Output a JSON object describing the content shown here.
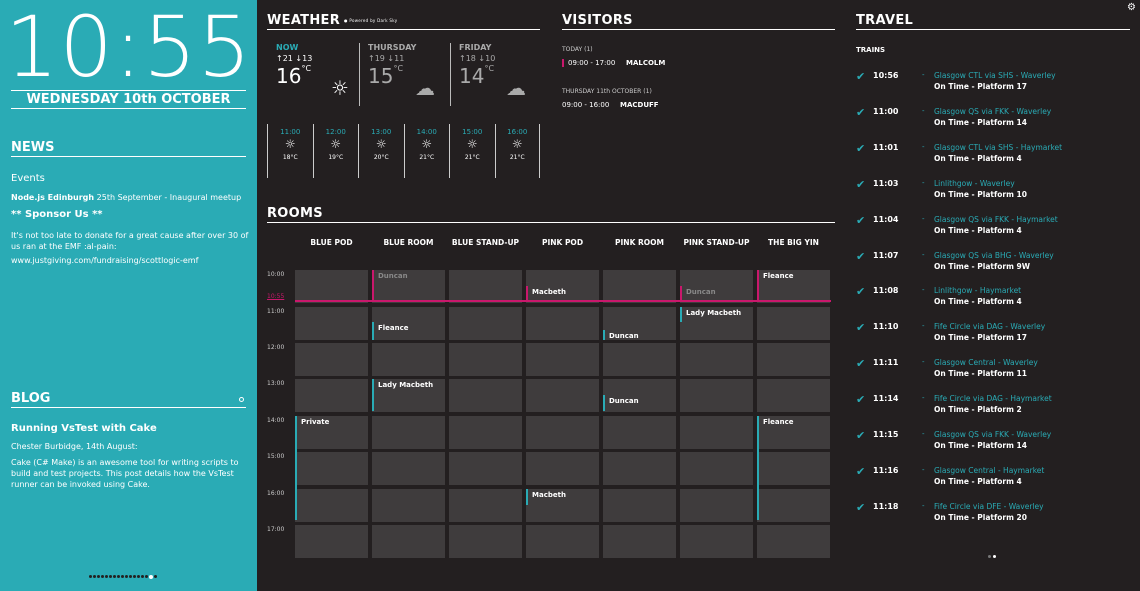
{
  "clock": {
    "time": "10:55",
    "date": "WEDNESDAY 10th OCTOBER"
  },
  "news": {
    "heading": "NEWS",
    "events_label": "Events",
    "event_title": "Node.js Edinburgh",
    "event_rest": " 25th September - Inaugural meetup",
    "sponsor": "** Sponsor Us **",
    "donate": "It's not too late to donate for a great cause after over 30 of us ran at the EMF :al-pain:",
    "link": "www.justgiving.com/fundraising/scottlogic-emf"
  },
  "blog": {
    "heading": "BLOG",
    "title": "Running VsTest with Cake",
    "author": "Chester Burbidge, 14th August:",
    "body": "Cake (C# Make) is an awesome tool for writing scripts to build and test projects. This post details how the VsTest runner can be invoked using Cake."
  },
  "weather": {
    "heading": "WEATHER",
    "powered": "Powered by Dark Sky",
    "days": [
      {
        "label": "NOW",
        "minmax": "↑21 ↓13",
        "temp": "16",
        "unit": "°C",
        "icon": "sun-icon",
        "glyph": "☼"
      },
      {
        "label": "THURSDAY",
        "minmax": "↑19 ↓11",
        "temp": "15",
        "unit": "°C",
        "icon": "rain-cloud-icon",
        "glyph": "☁"
      },
      {
        "label": "FRIDAY",
        "minmax": "↑18 ↓10",
        "temp": "14",
        "unit": "°C",
        "icon": "rain-cloud-icon",
        "glyph": "☁"
      }
    ],
    "hourly": [
      {
        "time": "11:00",
        "temp": "18°C"
      },
      {
        "time": "12:00",
        "temp": "19°C"
      },
      {
        "time": "13:00",
        "temp": "20°C"
      },
      {
        "time": "14:00",
        "temp": "21°C"
      },
      {
        "time": "15:00",
        "temp": "21°C"
      },
      {
        "time": "16:00",
        "temp": "21°C"
      }
    ]
  },
  "visitors": {
    "heading": "VISITORS",
    "today_label": "TODAY",
    "today_count": "(1)",
    "today_time": "09:00 - 17:00",
    "today_name": "MALCOLM",
    "thu_label": "THURSDAY 11th OCTOBER",
    "thu_count": "(1)",
    "thu_time": "09:00 - 16:00",
    "thu_name": "MACDUFF"
  },
  "rooms": {
    "heading": "ROOMS",
    "columns": [
      "BLUE POD",
      "BLUE ROOM",
      "BLUE STAND-UP",
      "PINK POD",
      "PINK ROOM",
      "PINK STAND-UP",
      "THE BIG YIN"
    ],
    "times": [
      "10:00",
      "11:00",
      "12:00",
      "13:00",
      "14:00",
      "15:00",
      "16:00",
      "17:00"
    ],
    "now_label": "10:55",
    "bookings": [
      {
        "room": 1,
        "name": "Duncan"
      },
      {
        "room": 6,
        "name": "Fleance"
      },
      {
        "room": 3,
        "name": "Macbeth"
      },
      {
        "room": 5,
        "name": "Duncan"
      },
      {
        "room": 1,
        "name": "Fleance"
      },
      {
        "room": 5,
        "name": "Lady Macbeth"
      },
      {
        "room": 4,
        "name": "Duncan"
      },
      {
        "room": 1,
        "name": "Lady Macbeth"
      },
      {
        "room": 4,
        "name": "Duncan"
      },
      {
        "room": 0,
        "name": "Private"
      },
      {
        "room": 6,
        "name": "Fleance"
      },
      {
        "room": 3,
        "name": "Macbeth"
      }
    ]
  },
  "travel": {
    "heading": "TRAVEL",
    "trains_label": "TRAINS",
    "dash": "-",
    "trains": [
      {
        "time": "10:56",
        "route": "Glasgow CTL via SHS  -  Waverley",
        "status": "On Time  -  Platform 17"
      },
      {
        "time": "11:00",
        "route": "Glasgow QS via FKK  -  Waverley",
        "status": "On Time  -  Platform 14"
      },
      {
        "time": "11:01",
        "route": "Glasgow CTL via SHS  -  Haymarket",
        "status": "On Time  -  Platform 4"
      },
      {
        "time": "11:03",
        "route": "Linlithgow  -  Waverley",
        "status": "On Time  -  Platform 10"
      },
      {
        "time": "11:04",
        "route": "Glasgow QS via FKK  -  Haymarket",
        "status": "On Time  -  Platform 4"
      },
      {
        "time": "11:07",
        "route": "Glasgow QS via BHG  -  Waverley",
        "status": "On Time  -  Platform 9W"
      },
      {
        "time": "11:08",
        "route": "Linlithgow  -  Haymarket",
        "status": "On Time  -  Platform 4"
      },
      {
        "time": "11:10",
        "route": "Fife Circle via DAG  -  Waverley",
        "status": "On Time  -  Platform 17"
      },
      {
        "time": "11:11",
        "route": "Glasgow Central  -  Waverley",
        "status": "On Time  -  Platform 11"
      },
      {
        "time": "11:14",
        "route": "Fife Circle via DAG  -  Haymarket",
        "status": "On Time  -  Platform 2"
      },
      {
        "time": "11:15",
        "route": "Glasgow QS via FKK  -  Waverley",
        "status": "On Time  -  Platform 14"
      },
      {
        "time": "11:16",
        "route": "Glasgow Central  -  Haymarket",
        "status": "On Time  -  Platform 4"
      },
      {
        "time": "11:18",
        "route": "Fife Circle via DFE  -  Waverley",
        "status": "On Time  -  Platform 20"
      }
    ]
  },
  "colors": {
    "accent": "#2aabb5",
    "pink": "#c9186c",
    "background": "#231f20",
    "cell": "#3f3c3d"
  }
}
